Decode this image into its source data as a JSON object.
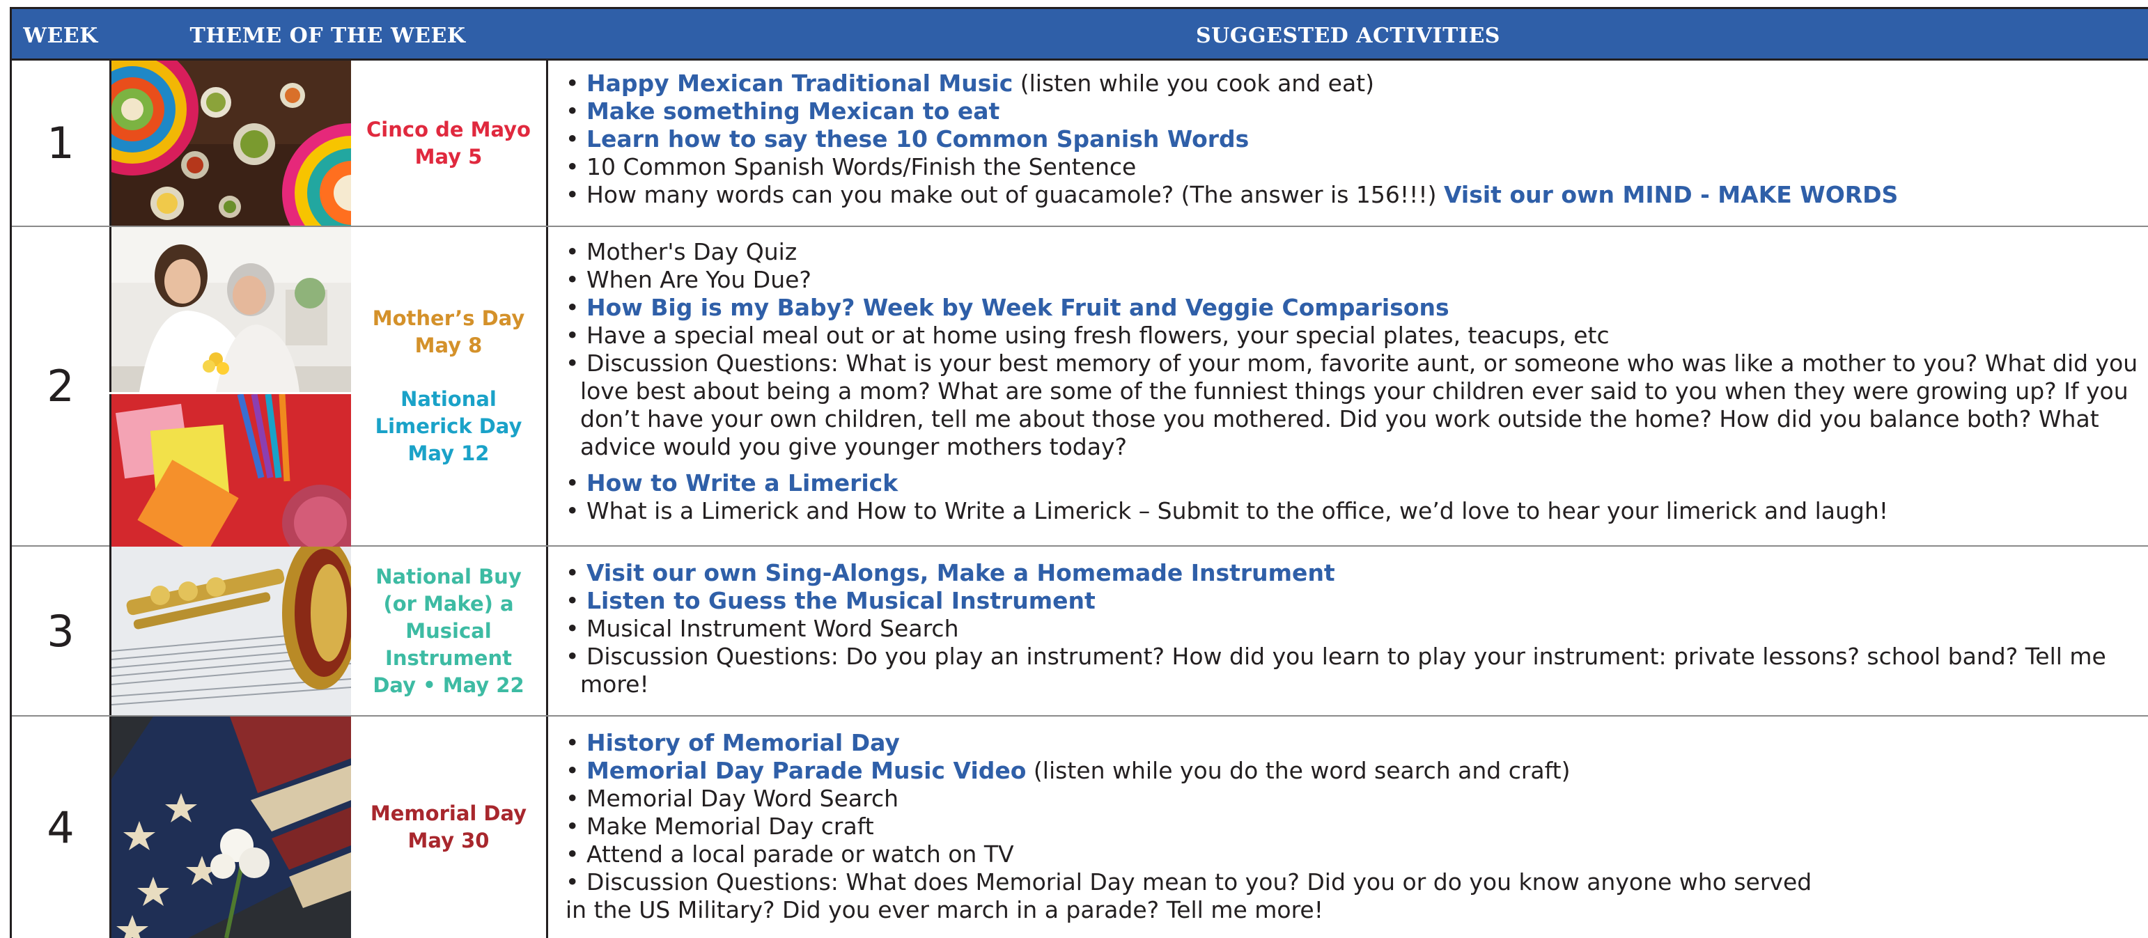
{
  "header": {
    "week": "WEEK",
    "theme": "THEME OF THE WEEK",
    "activities": "SUGGESTED ACTIVITIES"
  },
  "colors": {
    "header_bg": "#2f5fa8",
    "link": "#2f5fa8",
    "cinco": "#e0293e",
    "mothers": "#d4912a",
    "limerick": "#1aa2c8",
    "musical": "#3dbba3",
    "memorial": "#a8272d"
  },
  "weeks": [
    {
      "number": "1",
      "image_icon": "colorful-sombreros-food-photo",
      "themes": [
        [
          "Cinco de Mayo",
          "May 5"
        ]
      ],
      "activities": [
        {
          "link": "Happy Mexican Traditional Music",
          "text": " (listen while you cook and eat)"
        },
        {
          "link": "Make something Mexican to eat"
        },
        {
          "link": "Learn how to say these 10 Common Spanish Words"
        },
        {
          "text": "10 Common Spanish Words/Finish the Sentence"
        },
        {
          "text": "How many words can you make out of guacamole? (The answer is 156!!!) ",
          "link_after": "Visit our own MIND - MAKE WORDS"
        }
      ]
    },
    {
      "number": "2",
      "image_icons": [
        "mother-daughter-hug-photo",
        "sticky-notes-pencils-photo"
      ],
      "themes": [
        [
          "Mother’s Day",
          "May 8"
        ],
        [
          "National",
          "Limerick Day",
          "May 12"
        ]
      ],
      "activities": [
        {
          "text": "Mother's Day Quiz"
        },
        {
          "text": "When Are You Due?"
        },
        {
          "link": "How Big is my Baby? Week by Week Fruit and Veggie Comparisons"
        },
        {
          "text": "Have a special meal out or at home using fresh flowers, your special plates, teacups, etc"
        },
        {
          "text": "Discussion Questions: What is your best memory of your mom, favorite aunt, or someone who was like a mother to you? What did you love best about being a mom? What are some of the funniest things your children ever said to you when they were growing up? If you don’t have your own children, tell me about those you mothered. Did you work outside the home? How did you balance both? What advice would you give younger mothers today?"
        },
        {
          "link": "How to Write a Limerick"
        },
        {
          "text": "What is a Limerick and How to Write a Limerick – Submit to the office, we’d love to hear your limerick and laugh!"
        }
      ]
    },
    {
      "number": "3",
      "image_icon": "trumpet-sheet-music-photo",
      "themes": [
        [
          "National Buy",
          "(or Make) a",
          "Musical",
          "Instrument",
          "Day • May 22"
        ]
      ],
      "activities": [
        {
          "link": "Visit our own Sing-Alongs, Make a Homemade Instrument"
        },
        {
          "link": "Listen to Guess the Musical Instrument"
        },
        {
          "text": "Musical Instrument Word Search"
        },
        {
          "text": "Discussion Questions: Do you play an instrument? How did you learn to play your instrument: private lessons? school band? Tell me more!"
        }
      ]
    },
    {
      "number": "4",
      "image_icon": "american-flag-carnation-photo",
      "themes": [
        [
          "Memorial Day",
          "May 30"
        ]
      ],
      "activities": [
        {
          "link": "History of Memorial Day"
        },
        {
          "link": "Memorial Day Parade Music Video",
          "text": " (listen while you do the word search and craft)"
        },
        {
          "text": "Memorial Day Word Search"
        },
        {
          "text": "Make Memorial Day craft"
        },
        {
          "text": "Attend a local parade or watch on TV"
        },
        {
          "text": "Discussion Questions: What does Memorial Day mean to you? Did you or do you know anyone who served"
        },
        {
          "text": "in the US Military? Did you ever march in a parade? Tell me more!"
        }
      ]
    }
  ]
}
